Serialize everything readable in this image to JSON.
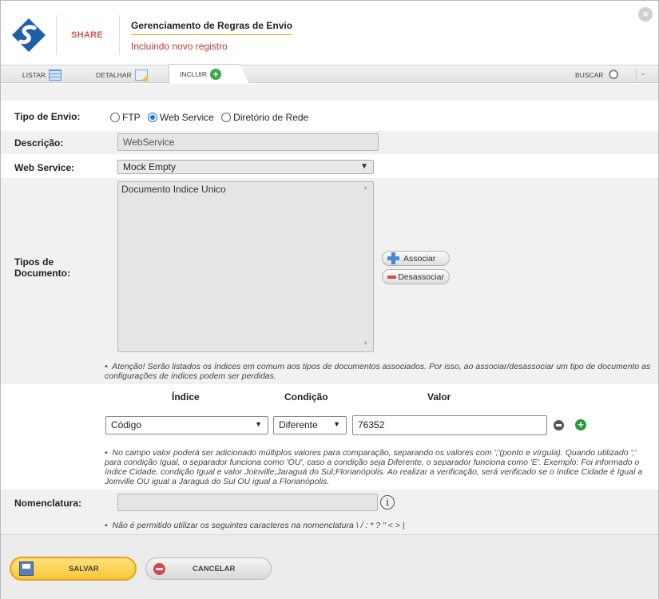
{
  "header": {
    "brand": "SHARE",
    "title": "Gerenciamento de Regras de Envio",
    "subtitle": "Incluindo novo registro"
  },
  "tabs": {
    "list": "LISTAR",
    "detail": "DETALHAR",
    "include": "INCLUIR",
    "search": "BUSCAR"
  },
  "form": {
    "send_type": {
      "label": "Tipo de Envio:",
      "options": [
        "FTP",
        "Web Service",
        "Diretório de Rede"
      ],
      "selected": "Web Service"
    },
    "description": {
      "label": "Descrição:",
      "value": "WebService"
    },
    "web_service": {
      "label": "Web Service:",
      "value": "Mock Empty"
    },
    "doc_types": {
      "label": "Tipos de Documento:",
      "items": [
        "Documento Indice Unico"
      ],
      "associate": "Associar",
      "disassociate": "Desassociar",
      "note": "Atenção! Serão listados os índices em comum aos tipos de documentos associados. Por isso, ao associar/desassociar um tipo de documento as configurações de índices podem ser perdidas."
    },
    "index_rule": {
      "col_index": "Índice",
      "col_condition": "Condição",
      "col_value": "Valor",
      "index": "Código",
      "condition": "Diferente",
      "value": "76352",
      "note": "No campo valor poderá ser adicionado múltiplos valores para comparação, separando os valores com ';'(ponto e vírgula). Quando utilizado ';' para condição Igual, o separador funciona como 'OU', caso a condição seja Diferente, o separador funciona como 'E'. Exemplo: Foi informado o índice Cidade, condição Igual e valor Joinville;Jaraguá do Sul;Florianópolis. Ao realizar a verificação, será verificado se o índice Cidade é Igual a Joinville OU igual a Jaraguá do Sul OU igual a Florianópolis."
    },
    "nomenclature": {
      "label": "Nomenclatura:",
      "value": "",
      "note": "Não é permitido utilizar os seguintes caracteres na nomenclatura \\ / : * ? \" < > |"
    }
  },
  "footer": {
    "save": "SALVAR",
    "cancel": "CANCELAR"
  }
}
